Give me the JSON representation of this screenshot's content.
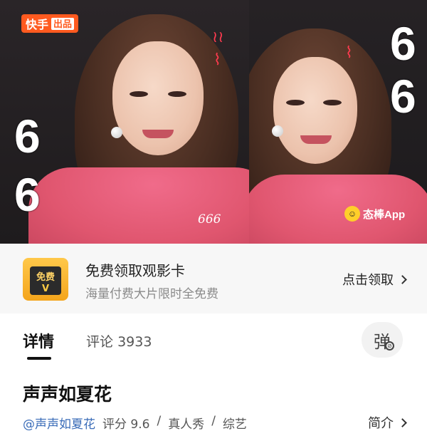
{
  "video": {
    "logo_text": "快手",
    "logo_sub": "出品",
    "overlay_text": "666",
    "big_digits": [
      "6",
      "6",
      "6",
      "6"
    ],
    "watermark": "态棒App"
  },
  "promo": {
    "badge_label": "免费",
    "badge_mark": "V",
    "title": "免费领取观影卡",
    "subtitle": "海量付费大片限时全免费",
    "cta": "点击领取"
  },
  "tabs": {
    "detail": "详情",
    "comments_label": "评论",
    "comments_count": "3933",
    "danmaku_label": "弹"
  },
  "show": {
    "title": "声声如夏花",
    "author": "@声声如夏花",
    "rating": "评分 9.6",
    "genre": "真人秀",
    "category": "综艺",
    "separator": "/",
    "intro_label": "简介"
  }
}
